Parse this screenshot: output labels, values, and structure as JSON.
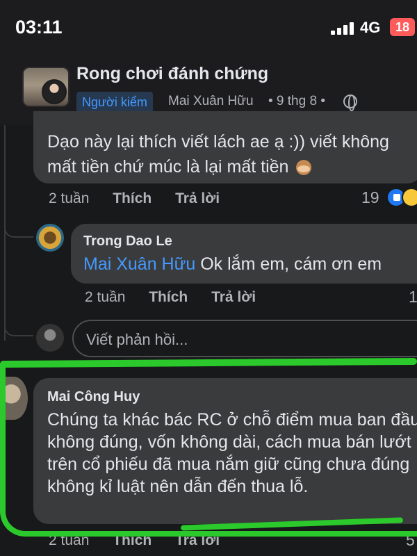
{
  "status_bar": {
    "time": "03:11",
    "network": "4G",
    "battery": "18"
  },
  "post": {
    "group_name": "Rong chơi đánh chứng",
    "badge": "Người kiểm",
    "author": "Mai Xuân Hữu",
    "meta": "• 9 thg 8 •"
  },
  "comments": [
    {
      "text": "Dạo này lại thích viết lách ae ạ :)) viết không mất tiền chứ múc là lại mất tiền",
      "time": "2 tuần",
      "like": "Thích",
      "reply": "Trả lời",
      "reaction_count": "19"
    },
    {
      "author": "Trong Dao Le",
      "mention": "Mai Xuân Hữu",
      "text": "Ok lắm em, cám ơn em",
      "time": "2 tuần",
      "like": "Thích",
      "reply": "Trả lời",
      "reaction_count": "1"
    },
    {
      "author": "Mai Công Huy",
      "text": "Chúng ta khác bác RC ở chỗ điểm mua ban đầu không đúng, vốn không dài, cách mua bán lướt trên cổ phiếu đã mua nắm giữ cũng chưa đúng không kỉ luật nên dẫn đến thua lỗ.",
      "time": "2 tuần",
      "like": "Thích",
      "reply": "Trả lời",
      "reaction_count": "5"
    }
  ],
  "reply_input": {
    "placeholder": "Viết phản hồi..."
  },
  "colors": {
    "background": "#18191a",
    "bubble": "#3a3b3c",
    "link": "#4599ff",
    "highlight": "#2bc92b"
  }
}
